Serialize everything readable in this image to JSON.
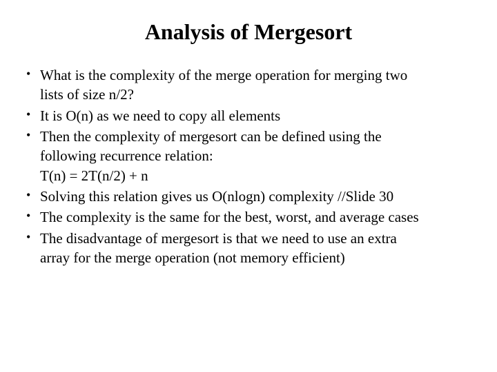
{
  "title": "Analysis of Mergesort",
  "bullets": {
    "b1a": "What is the complexity of the merge operation for merging two",
    "b1b": "lists of size n/2?",
    "b2": "It is O(n) as we need to copy all elements",
    "b3a": "Then the complexity of mergesort can be defined using the",
    "b3b": "following recurrence relation:",
    "b3c": "T(n) = 2T(n/2) + n",
    "b4": "Solving this relation gives us O(nlogn) complexity //Slide 30",
    "b5": "The complexity is the same for the best, worst, and average cases",
    "b6a": "The disadvantage of mergesort is that we need to use an extra",
    "b6b": "array for the merge operation (not memory efficient)"
  }
}
